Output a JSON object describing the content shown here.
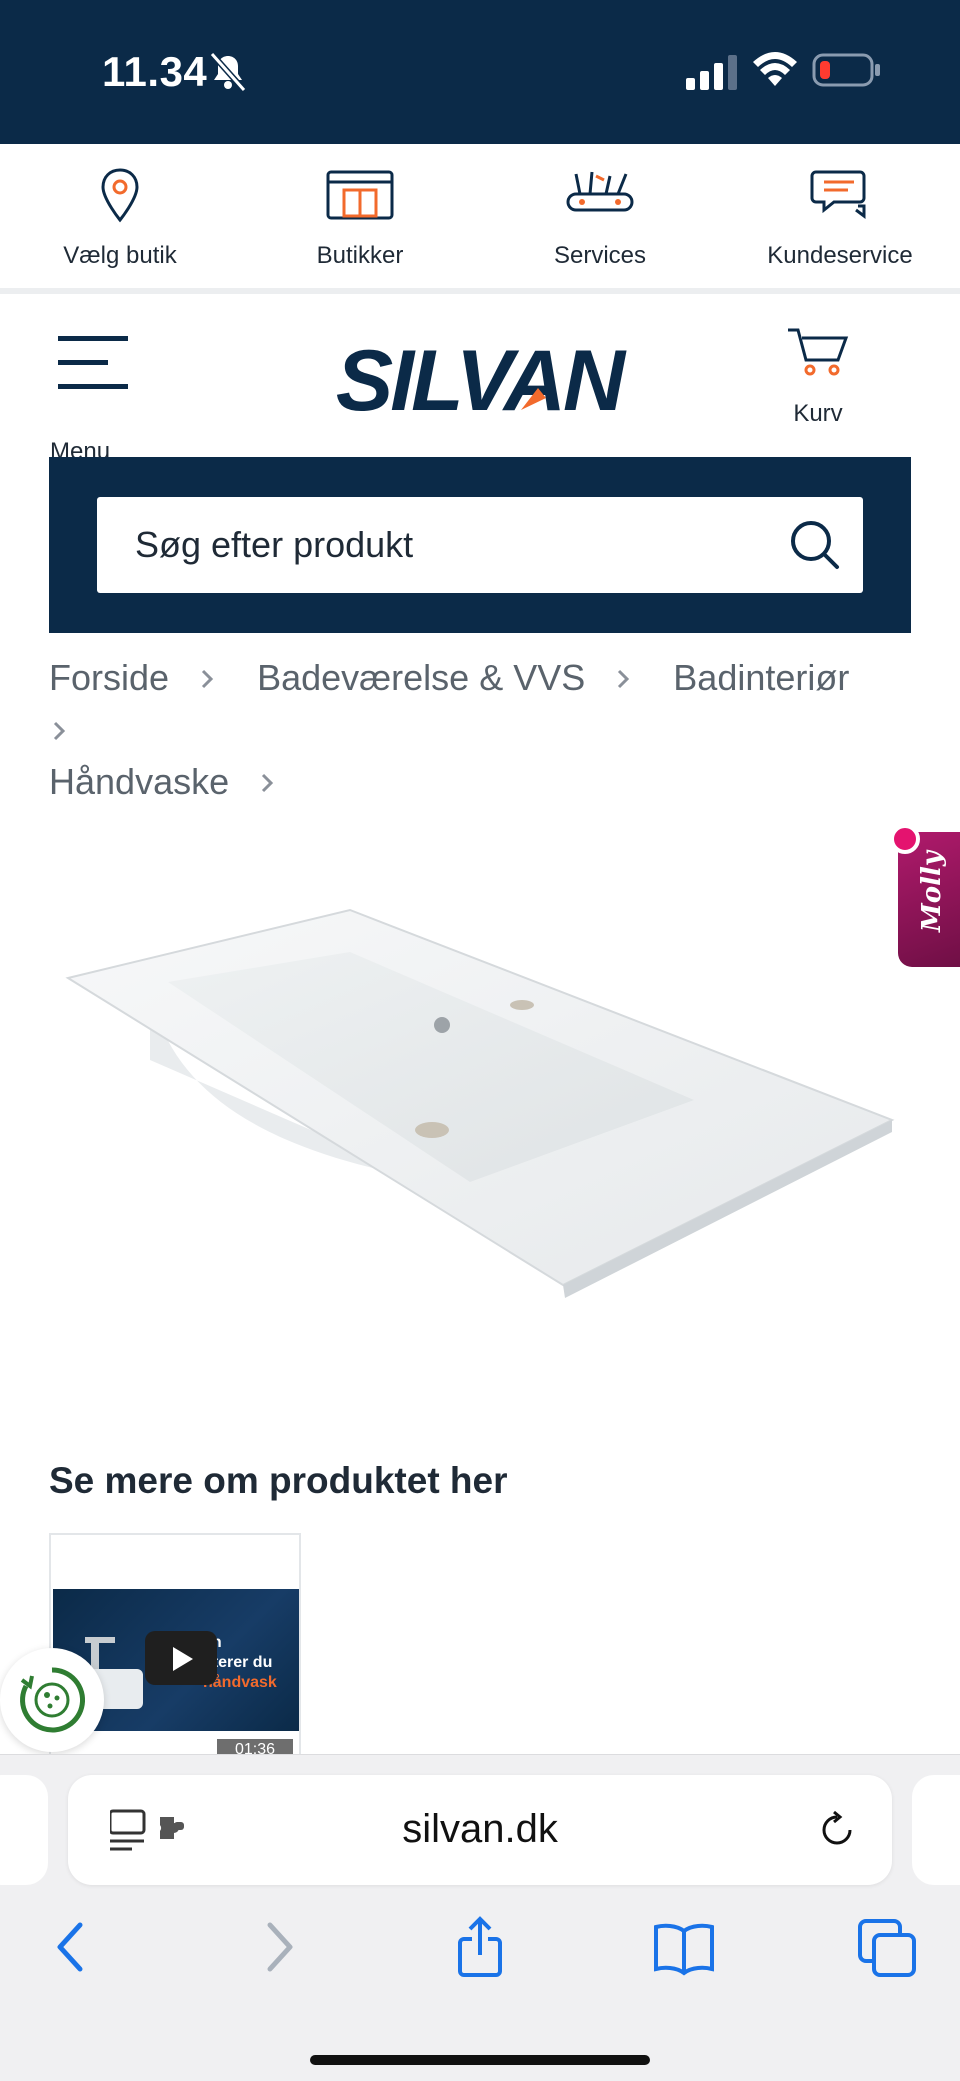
{
  "status_bar": {
    "time": "11.34"
  },
  "util_nav": {
    "items": [
      {
        "label": "Vælg butik",
        "icon": "location-pin-icon"
      },
      {
        "label": "Butikker",
        "icon": "store-icon"
      },
      {
        "label": "Services",
        "icon": "tools-icon"
      },
      {
        "label": "Kundeservice",
        "icon": "chat-bubbles-icon"
      }
    ]
  },
  "header": {
    "menu_label": "Menu",
    "logo_text": "SILVAN",
    "cart_label": "Kurv"
  },
  "search": {
    "placeholder": "Søg efter produkt"
  },
  "breadcrumb": {
    "items": [
      "Forside",
      "Badeværelse & VVS",
      "Badinteriør",
      "Håndvaske"
    ]
  },
  "chat_widget": {
    "label": "Molly"
  },
  "video_section": {
    "title": "Se mere om produktet her",
    "thumbnail_text_line1": "an",
    "thumbnail_text_line2": "nterer du",
    "thumbnail_text_line3": "håndvask",
    "duration": "01:36"
  },
  "safari": {
    "url": "silvan.dk"
  },
  "colors": {
    "brand_navy": "#0b2a48",
    "brand_orange": "#f26a2c",
    "molly_magenta": "#b01a6c",
    "safari_blue": "#1a73e8"
  }
}
